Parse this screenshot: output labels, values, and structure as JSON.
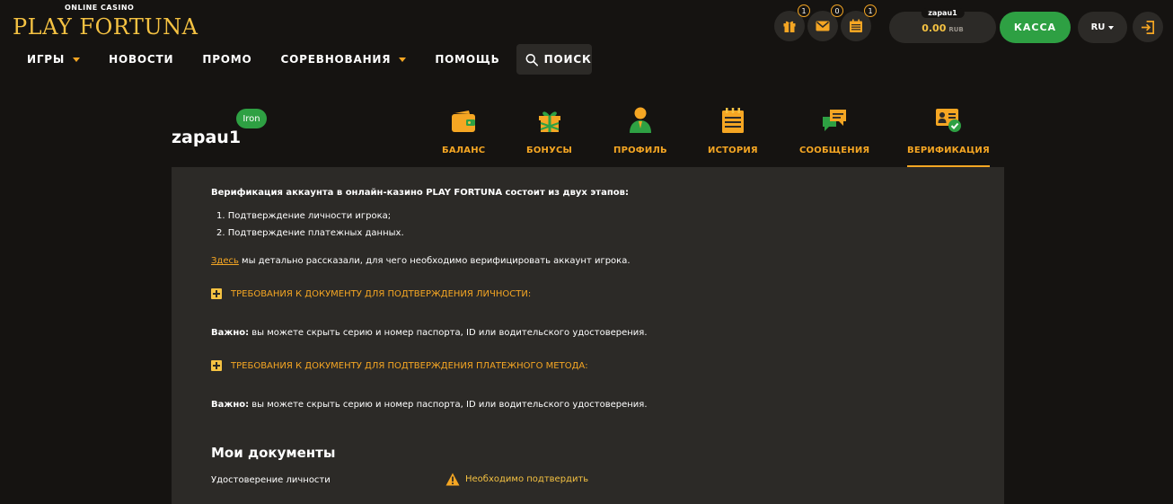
{
  "brand": {
    "subtitle": "ONLINE CASINO",
    "name": "PLAY FORTUNA",
    "accent": "#f5a623",
    "green": "#2ea043"
  },
  "nav": {
    "items": [
      {
        "label": "ИГРЫ",
        "dropdown": true
      },
      {
        "label": "НОВОСТИ",
        "dropdown": false
      },
      {
        "label": "ПРОМО",
        "dropdown": false
      },
      {
        "label": "СОРЕВНОВАНИЯ",
        "dropdown": true
      },
      {
        "label": "ПОМОЩЬ",
        "dropdown": false
      }
    ],
    "search_label": "ПОИСК"
  },
  "header_icons": [
    {
      "icon": "gift-icon",
      "badge": "1"
    },
    {
      "icon": "mail-icon",
      "badge": "0"
    },
    {
      "icon": "calendar-icon",
      "badge": "1"
    }
  ],
  "wallet": {
    "username": "zapau1",
    "balance": "0.00",
    "currency": "RUB"
  },
  "cashier_label": "КАССА",
  "language": "RU",
  "profile": {
    "username": "zapau1",
    "level": "Iron",
    "tabs": [
      {
        "label": "БАЛАНС",
        "icon": "wallet-icon"
      },
      {
        "label": "БОНУСЫ",
        "icon": "gift-box-icon"
      },
      {
        "label": "ПРОФИЛЬ",
        "icon": "user-icon"
      },
      {
        "label": "ИСТОРИЯ",
        "icon": "history-icon"
      },
      {
        "label": "СООБЩЕНИЯ",
        "icon": "chat-icon"
      },
      {
        "label": "ВЕРИФИКАЦИЯ",
        "icon": "id-card-check-icon",
        "active": true
      }
    ]
  },
  "verification": {
    "intro": "Верификация аккаунта в онлайн-казино PLAY FORTUNA состоит из двух этапов:",
    "steps": [
      "1. Подтверждение личности игрока;",
      "2. Подтверждение платежных данных."
    ],
    "here_link": "Здесь",
    "here_text": " мы детально рассказали, для чего необходимо верифицировать аккаунт игрока.",
    "accordion_identity": "ТРЕБОВАНИЯ К ДОКУМЕНТУ ДЛЯ ПОДТВЕРЖДЕНИЯ ЛИЧНОСТИ:",
    "note_label": "Важно:",
    "note_text": " вы можете скрыть серию и номер паспорта, ID или водительского удостоверения.",
    "accordion_payment": "ТРЕБОВАНИЯ К ДОКУМЕНТУ ДЛЯ ПОДТВЕРЖДЕНИЯ ПЛАТЕЖНОГО МЕТОДА:",
    "docs_title": "Мои документы",
    "doc_name": "Удостоверение личности",
    "doc_status": "Необходимо подтвердить"
  }
}
